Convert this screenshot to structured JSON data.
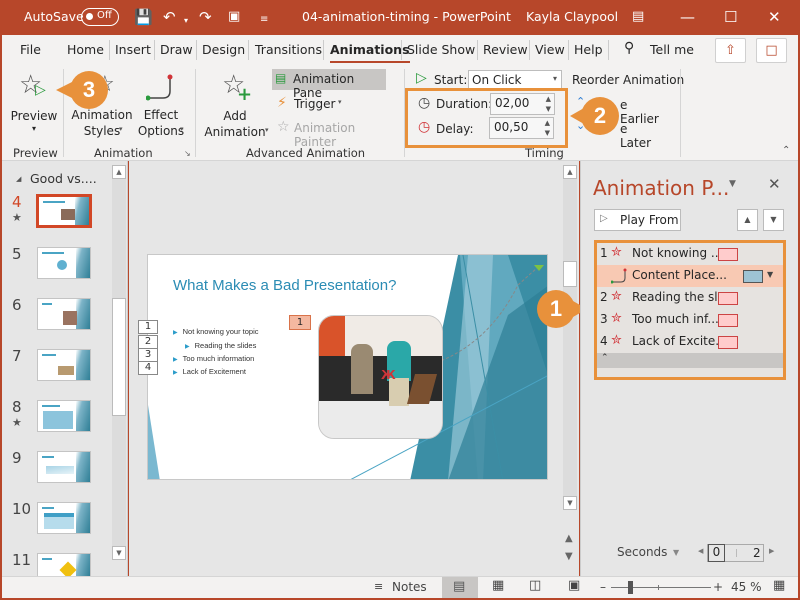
{
  "titlebar": {
    "autosave_label": "AutoSave",
    "autosave_state": "Off",
    "document_title": "04-animation-timing - PowerPoint",
    "user_name": "Kayla Claypool",
    "accent_color": "#b7472a"
  },
  "tabs": {
    "items": [
      "File",
      "Home",
      "Insert",
      "Draw",
      "Design",
      "Transitions",
      "Animations",
      "Slide Show",
      "Review",
      "View",
      "Help"
    ],
    "active": "Animations",
    "tell_me": "Tell me"
  },
  "ribbon": {
    "preview": {
      "button": "Preview",
      "group": "Preview"
    },
    "animation": {
      "styles_line1": "Animation",
      "styles_line2": "Styles",
      "effect_line1": "Effect",
      "effect_line2": "Options",
      "group": "Animation"
    },
    "advanced": {
      "add_line1": "Add",
      "add_line2": "Animation",
      "pane": "Animation Pane",
      "trigger": "Trigger",
      "painter": "Animation Painter",
      "group": "Advanced Animation"
    },
    "timing": {
      "start_label": "Start:",
      "start_value": "On Click",
      "duration_label": "Duration:",
      "duration_value": "02,00",
      "delay_label": "Delay:",
      "delay_value": "00,50",
      "reorder": "Reorder Animation",
      "move_earlier": "Move Earlier",
      "move_earlier_visible": "e Earlier",
      "move_later_visible": "e Later",
      "group": "Timing"
    }
  },
  "callouts": {
    "c1": "1",
    "c2": "2",
    "c3": "3"
  },
  "thumbnails": {
    "section": "Good vs....",
    "slides": [
      {
        "num": "4",
        "star": true,
        "selected": true
      },
      {
        "num": "5",
        "star": false,
        "selected": false
      },
      {
        "num": "6",
        "star": false,
        "selected": false
      },
      {
        "num": "7",
        "star": false,
        "selected": false
      },
      {
        "num": "8",
        "star": true,
        "selected": false
      },
      {
        "num": "9",
        "star": false,
        "selected": false
      },
      {
        "num": "10",
        "star": false,
        "selected": false
      },
      {
        "num": "11",
        "star": false,
        "selected": false
      }
    ]
  },
  "slide": {
    "title": "What Makes a Bad Presentation?",
    "tags": [
      "1",
      "2",
      "3",
      "4"
    ],
    "image_tag": "1",
    "bullets": [
      "Not knowing your topic",
      "Reading the slides",
      "Too much information",
      "Lack of Excitement"
    ]
  },
  "animation_pane": {
    "title": "Animation P...",
    "play_from": "Play From",
    "items": [
      {
        "num": "1",
        "label": "Not knowing ..."
      },
      {
        "num": "",
        "label": "Content Place..."
      },
      {
        "num": "2",
        "label": "Reading the sl..."
      },
      {
        "num": "3",
        "label": "Too much inf..."
      },
      {
        "num": "4",
        "label": "Lack of Excite..."
      }
    ],
    "seconds": "Seconds",
    "timeline_start": "0",
    "timeline_end": "2"
  },
  "status": {
    "notes": "Notes",
    "zoom": "45 %",
    "zoom_percent": 45
  }
}
